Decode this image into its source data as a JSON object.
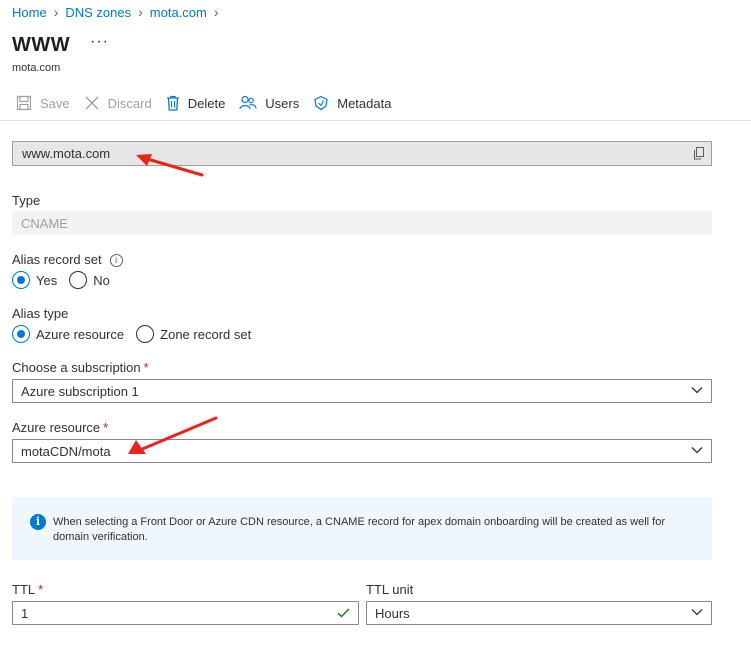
{
  "breadcrumb": {
    "items": [
      "Home",
      "DNS zones",
      "mota.com"
    ],
    "separator": ">"
  },
  "header": {
    "title": "WWW",
    "more_label": "···",
    "subtitle": "mota.com"
  },
  "toolbar": {
    "save": {
      "label": "Save",
      "icon": "save-icon",
      "enabled": false
    },
    "discard": {
      "label": "Discard",
      "icon": "close-icon",
      "enabled": false
    },
    "delete": {
      "label": "Delete",
      "icon": "trash-icon",
      "enabled": true
    },
    "users": {
      "label": "Users",
      "icon": "users-icon",
      "enabled": true
    },
    "metadata": {
      "label": "Metadata",
      "icon": "tag-icon",
      "enabled": true
    }
  },
  "form": {
    "name_value": "www.mota.com",
    "type": {
      "label": "Type",
      "value": "CNAME"
    },
    "alias_record_set": {
      "label": "Alias record set",
      "info_icon": "i",
      "options": [
        "Yes",
        "No"
      ],
      "selected": "Yes"
    },
    "alias_type": {
      "label": "Alias type",
      "options": [
        "Azure resource",
        "Zone record set"
      ],
      "selected": "Azure resource"
    },
    "subscription": {
      "label": "Choose a subscription",
      "required": "*",
      "value": "Azure subscription 1"
    },
    "azure_resource": {
      "label": "Azure resource",
      "required": "*",
      "value": "motaCDN/mota"
    },
    "info_message": "When selecting a Front Door or Azure CDN resource, a CNAME record for apex domain onboarding will be created as well for domain verification.",
    "ttl": {
      "label": "TTL",
      "required": "*",
      "value": "1"
    },
    "ttl_unit": {
      "label": "TTL unit",
      "value": "Hours"
    }
  },
  "colors": {
    "accent": "#0078d4",
    "arrow": "#e8251c",
    "required": "#a4262c",
    "valid": "#107c10"
  }
}
